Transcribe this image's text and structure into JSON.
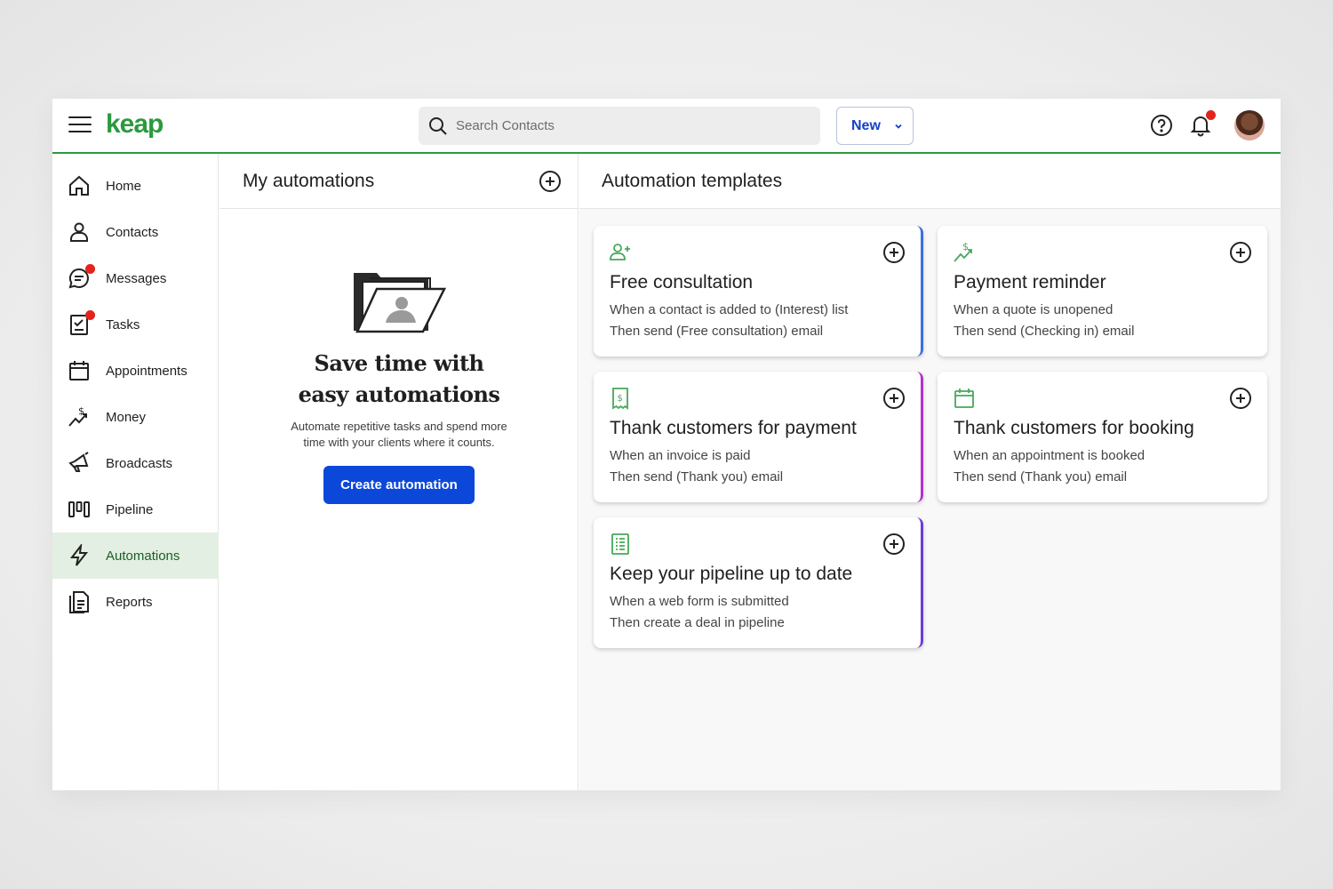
{
  "header": {
    "logo": "keap",
    "search_placeholder": "Search Contacts",
    "new_label": "New"
  },
  "sidebar": {
    "items": [
      {
        "label": "Home",
        "icon": "home-icon"
      },
      {
        "label": "Contacts",
        "icon": "person-icon"
      },
      {
        "label": "Messages",
        "icon": "chat-icon",
        "badge": true
      },
      {
        "label": "Tasks",
        "icon": "task-icon",
        "badge": true
      },
      {
        "label": "Appointments",
        "icon": "calendar-icon"
      },
      {
        "label": "Money",
        "icon": "money-icon"
      },
      {
        "label": "Broadcasts",
        "icon": "megaphone-icon"
      },
      {
        "label": "Pipeline",
        "icon": "pipeline-icon"
      },
      {
        "label": "Automations",
        "icon": "lightning-icon",
        "active": true
      },
      {
        "label": "Reports",
        "icon": "reports-icon"
      }
    ]
  },
  "my_automations": {
    "title": "My automations",
    "empty_title": "Save time with\neasy automations",
    "empty_desc": "Automate repetitive tasks and spend more\ntime with your clients where it counts.",
    "create_label": "Create automation"
  },
  "templates": {
    "title": "Automation templates",
    "cards": [
      {
        "title": "Free consultation",
        "line1": "When a contact is added to (Interest) list",
        "line2": "Then send (Free consultation) email",
        "icon": "add-person-icon"
      },
      {
        "title": "Payment reminder",
        "line1": "When a quote is unopened",
        "line2": "Then send (Checking in) email",
        "icon": "money-trend-icon"
      },
      {
        "title": "Thank customers for payment",
        "line1": "When an invoice is paid",
        "line2": "Then send (Thank you) email",
        "icon": "receipt-icon"
      },
      {
        "title": "Thank customers for booking",
        "line1": "When an appointment is booked",
        "line2": "Then send (Thank you) email",
        "icon": "calendar-icon"
      },
      {
        "title": "Keep your pipeline up to date",
        "line1": "When a web form is submitted",
        "line2": "Then create a deal in pipeline",
        "icon": "form-icon"
      }
    ]
  },
  "colors": {
    "brand_green": "#2b9a3e",
    "primary_blue": "#0b47d9",
    "badge_red": "#e3231c",
    "active_bg": "#e2efe2"
  }
}
